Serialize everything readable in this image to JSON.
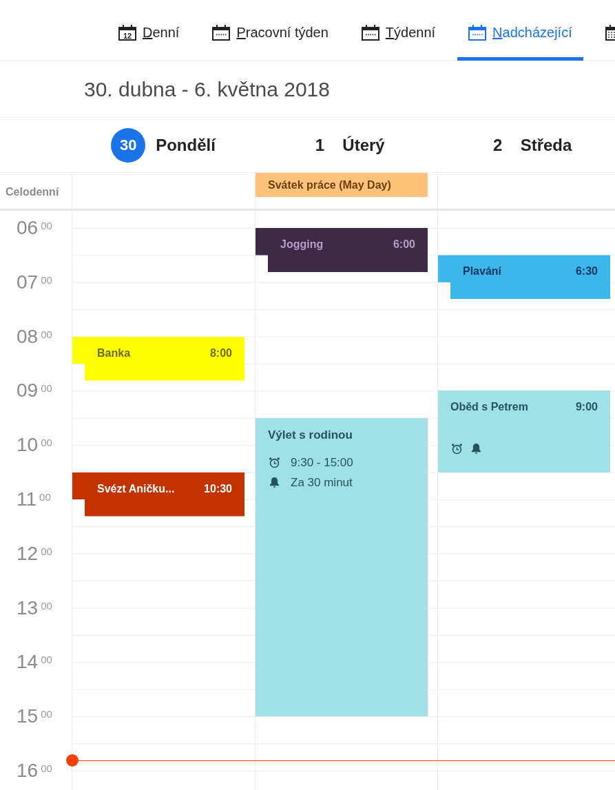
{
  "tabs": [
    {
      "kind": "day",
      "icon_text": "12",
      "label": "Denní",
      "selected": false
    },
    {
      "kind": "week",
      "label": "Pracovní týden",
      "selected": false
    },
    {
      "kind": "week",
      "label": "Týdenní",
      "selected": false
    },
    {
      "kind": "week",
      "label": "Nadcházející",
      "selected": true
    },
    {
      "kind": "month",
      "selected": false
    }
  ],
  "date_range": "30. dubna - 6. května 2018",
  "all_day_label": "Celodenní",
  "hours": [
    {
      "hour": "06",
      "minutes": "00"
    },
    {
      "hour": "07",
      "minutes": "00"
    },
    {
      "hour": "08",
      "minutes": "00"
    },
    {
      "hour": "09",
      "minutes": "00"
    },
    {
      "hour": "10",
      "minutes": "00"
    },
    {
      "hour": "11",
      "minutes": "00"
    },
    {
      "hour": "12",
      "minutes": "00"
    },
    {
      "hour": "13",
      "minutes": "00"
    },
    {
      "hour": "14",
      "minutes": "00"
    },
    {
      "hour": "15",
      "minutes": "00"
    },
    {
      "hour": "16",
      "minutes": "00"
    }
  ],
  "days": [
    {
      "number": "30",
      "name": "Pondělí",
      "today": true,
      "events": [
        {
          "kind": "short",
          "title": "Banka",
          "time": "8:00",
          "color": "#ffff00"
        },
        {
          "kind": "short",
          "title": "Svézt Aničku...",
          "time": "10:30",
          "color": "#c23300"
        }
      ]
    },
    {
      "number": "1",
      "name": "Úterý",
      "today": false,
      "all_day": [
        {
          "title": "Svátek práce (May Day)",
          "color": "#ffc27a"
        }
      ],
      "events": [
        {
          "kind": "short",
          "title": "Jogging",
          "time": "6:00",
          "color": "#3d2a45"
        },
        {
          "kind": "detailed",
          "title": "Výlet s rodinou",
          "time": "9:30 - 15:00",
          "reminder": "Za 30 minut",
          "color": "#a0e0e7"
        }
      ]
    },
    {
      "number": "2",
      "name": "Středa",
      "today": false,
      "events": [
        {
          "kind": "short",
          "title": "Plavání",
          "time": "6:30",
          "color": "#3db6ec"
        },
        {
          "kind": "icons",
          "title": "Oběd s Petrem",
          "time": "9:00",
          "color": "#a0e0e7"
        }
      ]
    }
  ]
}
